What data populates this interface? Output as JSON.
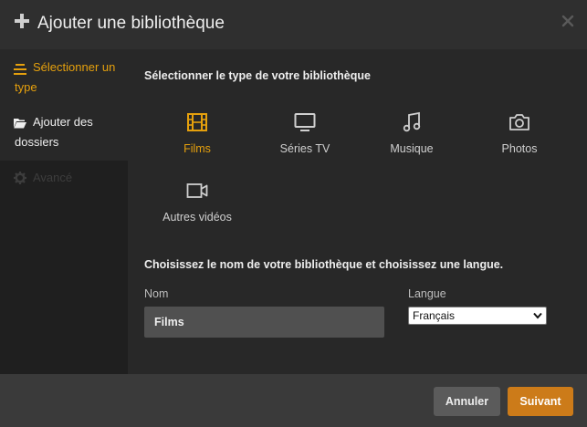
{
  "dialog": {
    "title": "Ajouter une bibliothèque",
    "accent_color": "#e5a00d"
  },
  "sidebar": {
    "items": [
      {
        "label": "Sélectionner un type",
        "icon": "list-icon",
        "state": "active"
      },
      {
        "label": "Ajouter des dossiers",
        "icon": "folder-open-icon",
        "state": "normal"
      },
      {
        "label": "Avancé",
        "icon": "gear-icon",
        "state": "disabled"
      }
    ]
  },
  "main": {
    "type_section_title": "Sélectionner le type de votre bibliothèque",
    "types": [
      {
        "label": "Films",
        "icon": "film-icon",
        "selected": true
      },
      {
        "label": "Séries TV",
        "icon": "tv-icon",
        "selected": false
      },
      {
        "label": "Musique",
        "icon": "music-note-icon",
        "selected": false
      },
      {
        "label": "Photos",
        "icon": "camera-icon",
        "selected": false
      },
      {
        "label": "Autres vidéos",
        "icon": "video-camera-icon",
        "selected": false
      }
    ],
    "name_section_title": "Choisissez le nom de votre bibliothèque et choisissez une langue.",
    "name_label": "Nom",
    "name_value": "Films",
    "language_label": "Langue",
    "language_value": "Français"
  },
  "footer": {
    "cancel_label": "Annuler",
    "next_label": "Suivant",
    "next_color": "#cc7b19"
  }
}
